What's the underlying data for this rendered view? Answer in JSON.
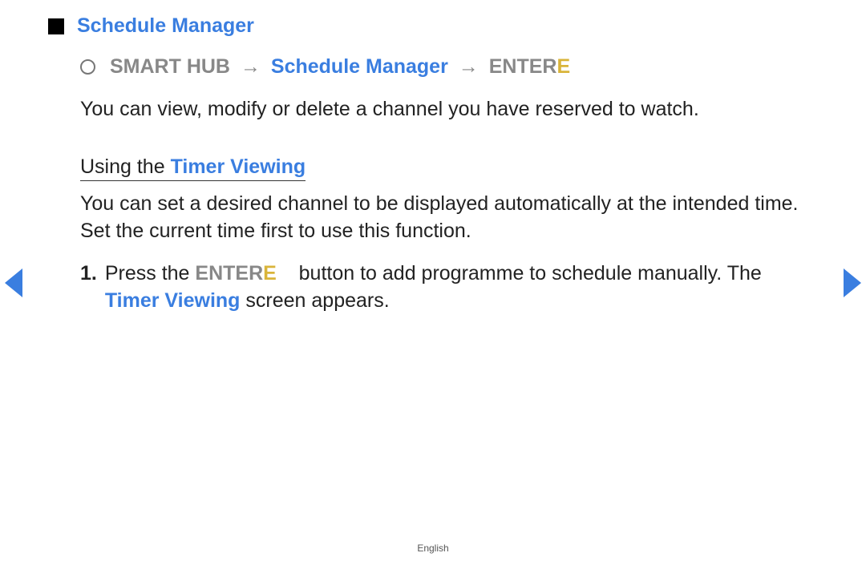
{
  "title": "Schedule Manager",
  "breadcrumb": {
    "item1": "SMART HUB",
    "item2": "Schedule Manager",
    "item3_prefix": "ENTER",
    "item3_suffix": "E",
    "arrow": "→"
  },
  "intro": "You can view, modify or delete a channel you have reserved to watch.",
  "section": {
    "prefix": "Using the ",
    "highlight": "Timer Viewing"
  },
  "section_body": "You can set a desired channel to be displayed automatically at the intended time. Set the current time first to use this function.",
  "list": {
    "num": "1.",
    "part1": "Press the ",
    "enter": "ENTER",
    "enterE": "E",
    "part2": " button to add programme to schedule manually. The ",
    "timer": "Timer Viewing",
    "part3": " screen appears."
  },
  "footer": "English"
}
